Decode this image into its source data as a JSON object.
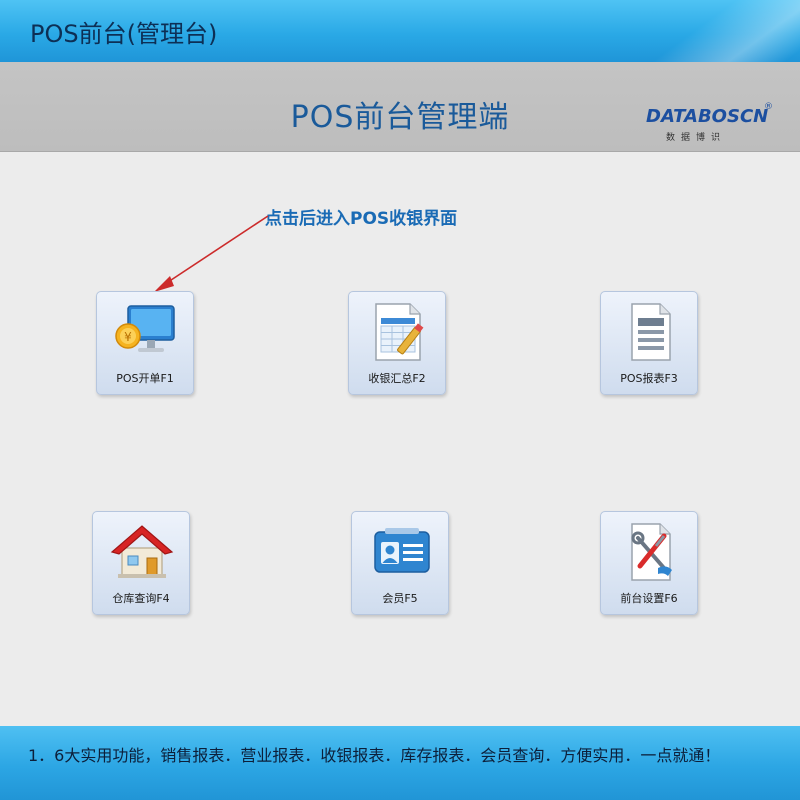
{
  "window": {
    "title": "POS前台(管理台)"
  },
  "header": {
    "title": "POS前台管理端"
  },
  "logo": {
    "brand": "DATABOSCN",
    "reg": "®",
    "sub": "数据博识"
  },
  "hint": {
    "text": "点击后进入POS收银界面"
  },
  "tiles": [
    {
      "label": "POS开单F1",
      "icon": "computer-coin-icon"
    },
    {
      "label": "收银汇总F2",
      "icon": "spreadsheet-pencil-icon"
    },
    {
      "label": "POS报表F3",
      "icon": "report-document-icon"
    },
    {
      "label": "仓库查询F4",
      "icon": "house-icon"
    },
    {
      "label": "会员F5",
      "icon": "member-card-icon"
    },
    {
      "label": "前台设置F6",
      "icon": "tools-settings-icon"
    }
  ],
  "footer": {
    "text": "1．6大实用功能，销售报表．营业报表．收银报表．库存报表．会员查询．方便实用．一点就通！"
  },
  "colors": {
    "accent": "#2aa9e6",
    "heading": "#1a5a9a",
    "hint": "#1a6bb5",
    "arrow": "#cc2b2b"
  }
}
